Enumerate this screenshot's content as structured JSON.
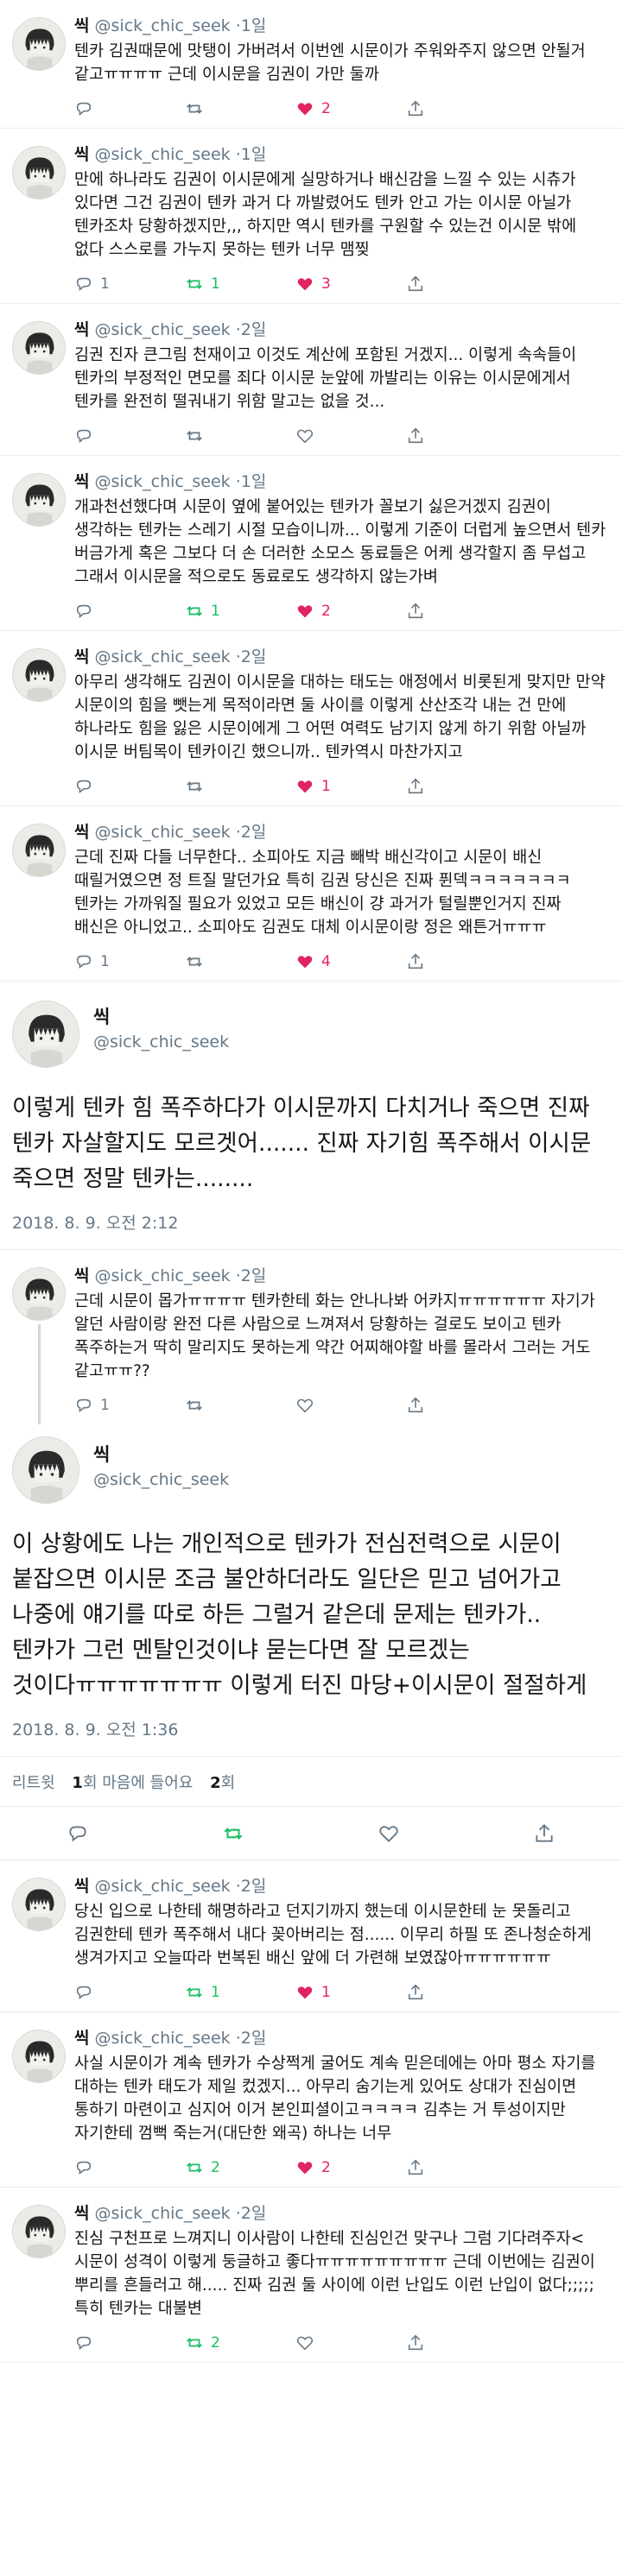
{
  "accent": "#1da1f2",
  "retweet_color": "#17bf63",
  "like_color": "#e0245e",
  "tweets_before": [
    {
      "name": "씩",
      "handle": "@sick_chic_seek",
      "time": "1일",
      "text": "텐카 김권때문에 맛탱이 가버려서 이번엔 시문이가 주워와주지 않으면 안될거 같고ㅠㅠㅠㅠ 근데 이시문을 김권이 가만 둘까",
      "replies": "",
      "retweets": "",
      "likes": "2",
      "liked": true,
      "retweeted": false
    },
    {
      "name": "씩",
      "handle": "@sick_chic_seek",
      "time": "1일",
      "text": "만에 하나라도 김권이 이시문에게 실망하거나 배신감을 느낄 수 있는 시츄가 있다면 그건 김권이 텐카 과거 다 까발렸어도 텐카 안고 가는 이시문 아닐가 텐카조차 당황하겠지만,,, 하지만 역시 텐카를 구원할 수 있는건 이시문 밖에 없다 스스로를 가누지 못하는 텐카 너무 맴찢",
      "replies": "1",
      "retweets": "1",
      "likes": "3",
      "liked": true,
      "retweeted": true
    },
    {
      "name": "씩",
      "handle": "@sick_chic_seek",
      "time": "2일",
      "text": "김권 진자 큰그림 천재이고 이것도 계산에 포함된 거겠지... 이렇게 속속들이 텐카의 부정적인 면모를 죄다 이시문 눈앞에 까발리는 이유는 이시문에게서 텐카를 완전히 떨궈내기 위함 말고는 없을 것...",
      "replies": "",
      "retweets": "",
      "likes": "",
      "liked": false,
      "retweeted": false
    },
    {
      "name": "씩",
      "handle": "@sick_chic_seek",
      "time": "1일",
      "text": "개과천선했다며 시문이 옆에 붙어있는 텐카가 꼴보기 싫은거겠지 김권이 생각하는 텐카는 스레기 시절 모습이니까... 이렇게 기준이 더럽게 높으면서 텐카 버금가게 혹은 그보다 더 손 더러한 소모스 동료들은 어케 생각할지 좀 무섭고 그래서 이시문을 적으로도 동료로도 생각하지 않는가벼",
      "replies": "",
      "retweets": "1",
      "likes": "2",
      "liked": true,
      "retweeted": true
    },
    {
      "name": "씩",
      "handle": "@sick_chic_seek",
      "time": "2일",
      "text": "아무리 생각해도 김권이 이시문을 대하는 태도는 애정에서 비롯된게 맞지만 만약 시문이의 힘을 뺏는게 목적이라면 둘 사이를 이렇게 산산조각 내는 건 만에 하나라도 힘을 잃은 시문이에게 그 어떤 여력도 남기지 않게 하기 위함 아닐까 이시문 버팀목이 텐카이긴 했으니까.. 텐카역시 마찬가지고",
      "replies": "",
      "retweets": "",
      "likes": "1",
      "liked": true,
      "retweeted": false
    },
    {
      "name": "씩",
      "handle": "@sick_chic_seek",
      "time": "2일",
      "text": "근데 진짜 다들 너무한다.. 소피아도 지금 빼박 배신각이고 시문이 배신 때릴거였으면 정 트질 말던가요 특히 김권 당신은 진짜 퓐덱ㅋㅋㅋㅋㅋㅋㅋ 텐카는 가까워질 필요가 있었고 모든 배신이 걍 과거가 털릴뿐인거지 진짜 배신은 아니었고.. 소피아도 김권도 대체 이시문이랑 정은 왜튼거ㅠㅠㅠ",
      "replies": "1",
      "retweets": "",
      "likes": "4",
      "liked": true,
      "retweeted": false
    }
  ],
  "focus_tweet": {
    "name": "씩",
    "handle": "@sick_chic_seek",
    "text": "이렇게 텐카 힘 폭주하다가 이시문까지 다치거나 죽으면 진짜 텐카 자살할지도 모르겟어....... 진짜 자기힘 폭주해서 이시문 죽으면 정말 텐카는........",
    "date": "2018. 8. 9. 오전 2:12"
  },
  "reply_tweet": {
    "name": "씩",
    "handle": "@sick_chic_seek",
    "time": "2일",
    "text": "근데 시문이 몹가ㅠㅠㅠㅠ 텐카한테 화는 안나나봐 어카지ㅠㅠㅠㅠㅠㅠ 자기가 알던 사람이랑 완전 다른 사람으로 느껴져서 당황하는 걸로도 보이고 텐카 폭주하는거 딱히 말리지도 못하는게 약간 어찌해야할 바를 몰라서 그러는 거도 같고ㅠㅠ??",
    "replies": "1",
    "retweets": "",
    "likes": "",
    "liked": false,
    "retweeted": false
  },
  "main_tweet": {
    "name": "씩",
    "handle": "@sick_chic_seek",
    "text": "이 상황에도 나는 개인적으로 텐카가 전심전력으로 시문이 붙잡으면 이시문 조금 불안하더라도 일단은 믿고 넘어가고 나중에 얘기를 따로 하든 그럴거 같은데 문제는 텐카가.. 텐카가 그런 멘탈인것이냐 묻는다면 잘 모르겠는 것이다ㅠㅠㅠㅠㅠㅠㅠ 이렇게 터진 마당+이시문이 절절하게",
    "date": "2018. 8. 9. 오전 1:36",
    "stats_retweets_label": "리트윗",
    "stats_retweets": "1",
    "stats_likes_label": "회 마음에 들어요",
    "stats_likes": "2",
    "stats_likes_suffix": "회",
    "stats_retweets_suffix": "회"
  },
  "tweets_after": [
    {
      "name": "씩",
      "handle": "@sick_chic_seek",
      "time": "2일",
      "text": "당신 입으로 나한테 해명하라고 던지기까지 했는데 이시문한테 눈 못돌리고 김권한테 텐카 폭주해서 내다 꽂아버리는 점...... 이무리 하필 또 존나청순하게 생겨가지고 오늘따라 번복된 배신 앞에 더 가련해 보였잖아ㅠㅠㅠㅠㅠㅠ",
      "replies": "",
      "retweets": "1",
      "likes": "1",
      "liked": true,
      "retweeted": true
    },
    {
      "name": "씩",
      "handle": "@sick_chic_seek",
      "time": "2일",
      "text": "사실 시문이가 계속 텐카가 수상쩍게 굴어도 계속 믿은데에는 아마 평소 자기를 대하는 텐카 태도가 제일 컸겠지... 아무리 숨기는게 있어도 상대가 진심이면 통하기 마련이고 심지어 이거 본인피셜이고ㅋㅋㅋㅋ 김추는 거 투성이지만 자기한테 껌뻑 죽는거(대단한 왜곡) 하나는 너무",
      "replies": "",
      "retweets": "2",
      "likes": "2",
      "liked": true,
      "retweeted": true
    },
    {
      "name": "씩",
      "handle": "@sick_chic_seek",
      "time": "2일",
      "text": "진심 구천프로 느껴지니 이사람이 나한테 진심인건 맞구나 그럼 기다려주자<시문이 성격이 이렇게 둥글하고 좋다ㅠㅠㅠㅠㅠㅠㅠㅠㅠ 근데 이번에는 김권이 뿌리를 흔들러고 해..... 진짜 김권 둘 사이에 이런 난입도 이런 난입이 없다;;;;; 특히 텐카는 대불변",
      "replies": "",
      "retweets": "2",
      "likes": "",
      "liked": false,
      "retweeted": true
    }
  ]
}
